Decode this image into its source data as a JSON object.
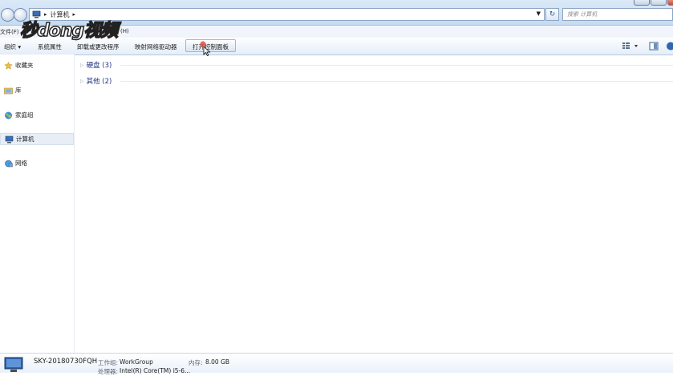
{
  "window": {
    "address_crumbs": [
      "计算机"
    ],
    "search_placeholder": "搜索 计算机"
  },
  "menubar": {
    "file": "文件(F)",
    "help": "(H)"
  },
  "watermark": {
    "text": "秒dong视频"
  },
  "toolbar": {
    "organize": "组织 ▾",
    "system_properties": "系统属性",
    "uninstall": "卸载或更改程序",
    "map_drive": "映射网络驱动器",
    "control_panel": "打开控制面板"
  },
  "sidebar": {
    "items": [
      {
        "label": "收藏夹",
        "icon": "star-icon"
      },
      {
        "label": "库",
        "icon": "library-icon"
      },
      {
        "label": "家庭组",
        "icon": "homegroup-icon"
      },
      {
        "label": "计算机",
        "icon": "computer-icon",
        "selected": true
      },
      {
        "label": "网络",
        "icon": "network-icon"
      }
    ]
  },
  "main": {
    "groups": [
      {
        "label": "硬盘 (3)"
      },
      {
        "label": "其他 (2)"
      }
    ]
  },
  "details": {
    "computer_name": "SKY-20180730FQH",
    "workgroup_label": "工作组:",
    "workgroup_value": "WorkGroup",
    "memory_label": "内存:",
    "memory_value": "8.00 GB",
    "processor_label": "处理器:",
    "processor_value": "Intel(R) Core(TM) i5-6..."
  },
  "colors": {
    "accent": "#1e3287",
    "titlebar": "#c6dbf0",
    "selection": "#e8eef6"
  }
}
